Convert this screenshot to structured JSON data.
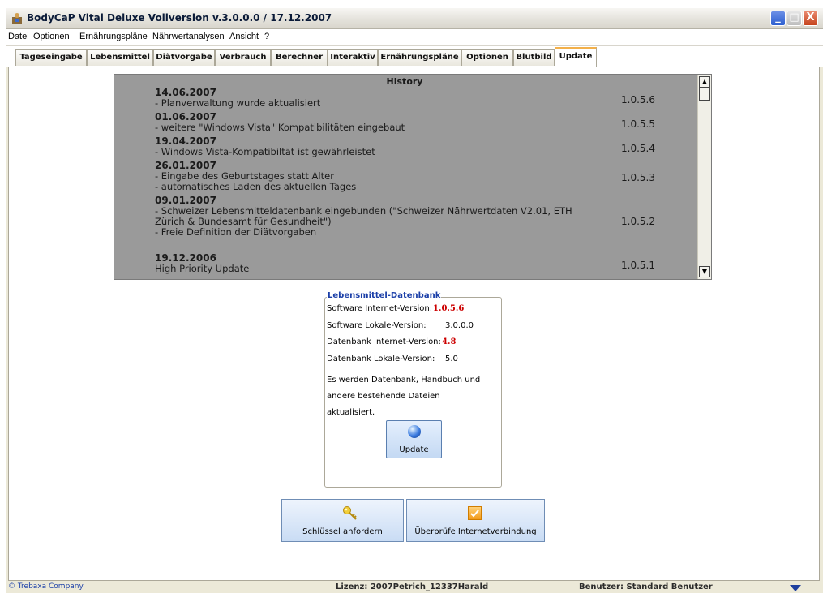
{
  "window": {
    "title": "BodyCaP Vital Deluxe Vollversion v.3.0.0.0 / 17.12.2007",
    "buttons": {
      "minimize": "_",
      "maximize": "□",
      "close": "X"
    }
  },
  "menu": [
    "Datei",
    "Optionen",
    "Ernährungspläne",
    "Nährwertanalysen",
    "Ansicht",
    "?"
  ],
  "tabs": [
    "Tageseingabe",
    "Lebensmittel",
    "Diätvorgabe",
    "Verbrauch",
    "Berechner",
    "Interaktiv",
    "Ernährungspläne",
    "Optionen",
    "Blutbild",
    "Update"
  ],
  "active_tab": "Update",
  "history": {
    "title": "History",
    "entries": [
      {
        "date": "14.06.2007",
        "lines": [
          "- Planverwaltung wurde aktualisiert"
        ],
        "version": "1.0.5.6"
      },
      {
        "date": "01.06.2007",
        "lines": [
          "- weitere \"Windows Vista\" Kompatibilitäten eingebaut"
        ],
        "version": "1.0.5.5"
      },
      {
        "date": "19.04.2007",
        "lines": [
          "- Windows Vista-Kompatibiltät ist gewährleistet"
        ],
        "version": "1.0.5.4"
      },
      {
        "date": "26.01.2007",
        "lines": [
          "- Eingabe des Geburtstages statt Alter",
          "- automatisches Laden des aktuellen Tages"
        ],
        "version": "1.0.5.3"
      },
      {
        "date": "09.01.2007",
        "lines": [
          "- Schweizer Lebensmitteldatenbank eingebunden (\"Schweizer Nährwertdaten V2.01, ETH",
          "Zürich & Bundesamt für Gesundheit\")",
          "- Freie Definition der Diätvorgaben"
        ],
        "version": "1.0.5.2"
      },
      {
        "date": "19.12.2006",
        "lines": [
          "High Priority Update"
        ],
        "version": "1.0.5.1"
      }
    ]
  },
  "database": {
    "title": "Lebensmittel-Datenbank",
    "rows": [
      {
        "label": "Software Internet-Version:",
        "value": "1.0.5.6"
      },
      {
        "label": "Software Lokale-Version:",
        "value": "3.0.0.0"
      },
      {
        "label": "Datenbank Internet-Version:",
        "value": "4.8"
      },
      {
        "label": "Datenbank Lokale-Version:",
        "value": "5.0"
      }
    ],
    "info_lines": [
      "Es werden Datenbank, Handbuch und",
      "andere bestehende Dateien",
      "aktualisiert."
    ],
    "update_label": "Update"
  },
  "actions": {
    "request_key": "Schlüssel anfordern",
    "check_connection": "Überprüfe Internetverbindung"
  },
  "status": {
    "company": "© Trebaxa Company",
    "license": "Lizenz: 2007Petrich_12337Harald",
    "user": "Benutzer: Standard Benutzer"
  },
  "icons": {
    "app": "app-icon",
    "update": "globe-icon",
    "key": "key-icon",
    "check": "checkmark-icon"
  },
  "colors": {
    "history_bg": "#9a9a9a",
    "accent_red": "#cc0000",
    "group_title": "#1b3fa8",
    "tab_highlight": "#f3b04a"
  }
}
